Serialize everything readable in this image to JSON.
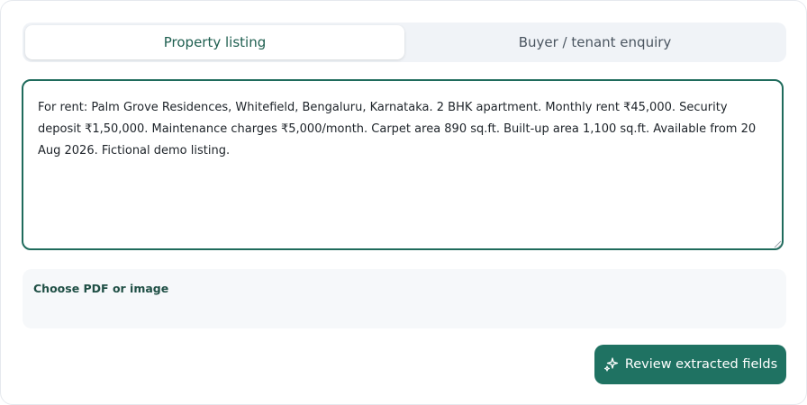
{
  "tabs": [
    {
      "label": "Property listing",
      "active": true
    },
    {
      "label": "Buyer / tenant enquiry",
      "active": false
    }
  ],
  "listing_text": "For rent: Palm Grove Residences, Whitefield, Bengaluru, Karnataka. 2 BHK apartment. Monthly rent ₹45,000. Security deposit ₹1,50,000. Maintenance charges ₹5,000/month. Carpet area 890 sq.ft. Built-up area 1,100 sq.ft. Available from 20 Aug 2026. Fictional demo listing.",
  "upload": {
    "label": "Choose PDF or image"
  },
  "actions": {
    "review_label": "Review extracted fields",
    "icon": "sparkles-icon"
  },
  "colors": {
    "accent": "#1f7262",
    "border": "#1f6b5c",
    "tab_bg": "#f0f3f7"
  }
}
